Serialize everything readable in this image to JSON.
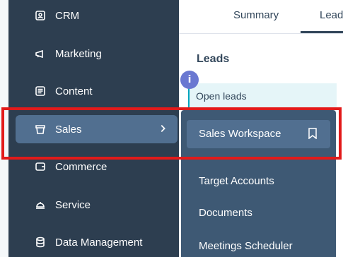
{
  "sidebar": {
    "items": [
      {
        "label": "CRM",
        "icon": "crm-icon"
      },
      {
        "label": "Marketing",
        "icon": "megaphone-icon"
      },
      {
        "label": "Content",
        "icon": "content-icon"
      },
      {
        "label": "Sales",
        "icon": "sales-icon",
        "active": true
      },
      {
        "label": "Commerce",
        "icon": "commerce-icon"
      },
      {
        "label": "Service",
        "icon": "service-icon"
      },
      {
        "label": "Data Management",
        "icon": "database-icon"
      }
    ]
  },
  "header": {
    "tabs": [
      {
        "label": "Summary"
      },
      {
        "label": "Leads"
      }
    ]
  },
  "main": {
    "section_title": "Leads",
    "row_label": "Open leads",
    "info_badge": "i"
  },
  "flyout": {
    "active_item": "Sales Workspace",
    "items": [
      "Target Accounts",
      "Documents",
      "Meetings Scheduler"
    ]
  },
  "colors": {
    "sidebar_bg": "#2d3e50",
    "active_bg": "#516f90",
    "flyout_bg": "#3e5974",
    "highlight": "#e21a1a",
    "accent": "#00a4bd",
    "badge": "#6a78d1"
  }
}
